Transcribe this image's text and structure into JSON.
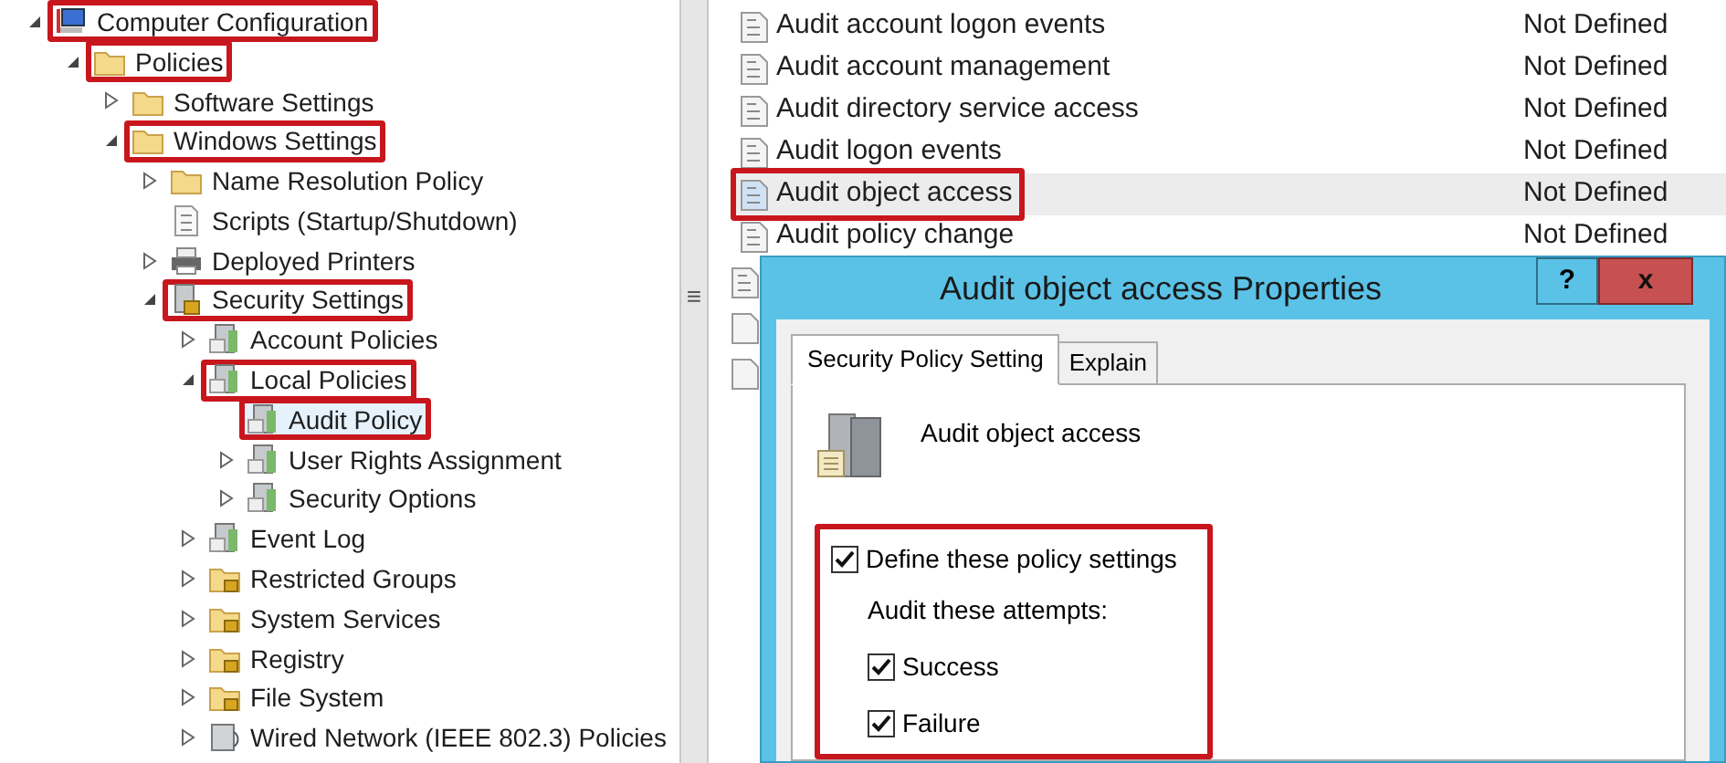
{
  "tree": [
    {
      "label": "Computer Configuration",
      "kind": "computer",
      "expanded": true,
      "highlighted": true,
      "children": [
        {
          "label": "Policies",
          "kind": "folder",
          "expanded": true,
          "highlighted": true,
          "children": [
            {
              "label": "Software Settings",
              "kind": "folder",
              "expanded": false,
              "highlighted": false
            },
            {
              "label": "Windows Settings",
              "kind": "folder",
              "expanded": true,
              "highlighted": true,
              "children": [
                {
                  "label": "Name Resolution Policy",
                  "kind": "folder",
                  "expanded": false,
                  "highlighted": false
                },
                {
                  "label": "Scripts (Startup/Shutdown)",
                  "kind": "script",
                  "highlighted": false
                },
                {
                  "label": "Deployed Printers",
                  "kind": "printer",
                  "expanded": false,
                  "highlighted": false
                },
                {
                  "label": "Security Settings",
                  "kind": "secure",
                  "expanded": true,
                  "highlighted": true,
                  "children": [
                    {
                      "label": "Account Policies",
                      "kind": "server",
                      "expanded": false,
                      "highlighted": false
                    },
                    {
                      "label": "Local Policies",
                      "kind": "server",
                      "expanded": true,
                      "highlighted": true,
                      "children": [
                        {
                          "label": "Audit Policy",
                          "kind": "server",
                          "highlighted": true,
                          "selected": true
                        },
                        {
                          "label": "User Rights Assignment",
                          "kind": "server",
                          "expanded": false,
                          "highlighted": false,
                          "selected": false
                        },
                        {
                          "label": "Security Options",
                          "kind": "server",
                          "expanded": false,
                          "highlighted": false,
                          "selected": false
                        }
                      ]
                    },
                    {
                      "label": "Event Log",
                      "kind": "server",
                      "expanded": false,
                      "highlighted": false
                    },
                    {
                      "label": "Restricted Groups",
                      "kind": "lockfolder",
                      "expanded": false,
                      "highlighted": false
                    },
                    {
                      "label": "System Services",
                      "kind": "lockfolder",
                      "expanded": false,
                      "highlighted": false
                    },
                    {
                      "label": "Registry",
                      "kind": "lockfolder",
                      "expanded": false,
                      "highlighted": false
                    },
                    {
                      "label": "File System",
                      "kind": "lockfolder",
                      "expanded": false,
                      "highlighted": false
                    },
                    {
                      "label": "Wired Network (IEEE 802.3) Policies",
                      "kind": "network",
                      "expanded": false,
                      "highlighted": false
                    }
                  ]
                }
              ]
            }
          ]
        }
      ]
    }
  ],
  "splitter": {
    "glyph": "≡"
  },
  "policies": [
    {
      "name": "Audit account logon events",
      "setting": "Not Defined",
      "selected": false,
      "highlighted": false
    },
    {
      "name": "Audit account management",
      "setting": "Not Defined",
      "selected": false,
      "highlighted": false
    },
    {
      "name": "Audit directory service access",
      "setting": "Not Defined",
      "selected": false,
      "highlighted": false
    },
    {
      "name": "Audit logon events",
      "setting": "Not Defined",
      "selected": false,
      "highlighted": false
    },
    {
      "name": "Audit object access",
      "setting": "Not Defined",
      "selected": true,
      "highlighted": true
    },
    {
      "name": "Audit policy change",
      "setting": "Not Defined",
      "selected": false,
      "highlighted": false
    }
  ],
  "dialog": {
    "title": "Audit object access Properties",
    "help": "?",
    "close": "x",
    "tabs": [
      {
        "label": "Security Policy Setting",
        "selected": true
      },
      {
        "label": "Explain",
        "selected": false
      }
    ],
    "policy_name": "Audit object access",
    "define": {
      "label": "Define these policy settings",
      "checked": true
    },
    "attempts_label": "Audit these attempts:",
    "attempts": [
      {
        "label": "Success",
        "checked": true
      },
      {
        "label": "Failure",
        "checked": true
      }
    ]
  }
}
